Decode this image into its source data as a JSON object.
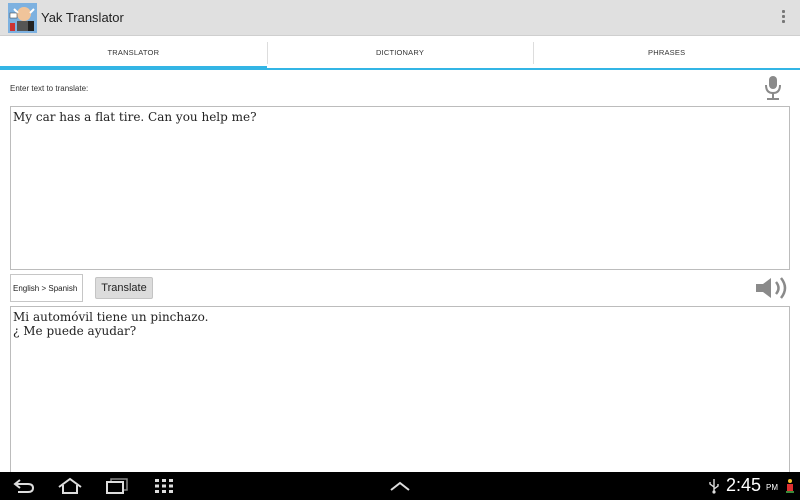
{
  "app": {
    "title": "Yak Translator"
  },
  "tabs": [
    {
      "label": "TRANSLATOR",
      "active": true
    },
    {
      "label": "DICTIONARY",
      "active": false
    },
    {
      "label": "PHRASES",
      "active": false
    }
  ],
  "translator": {
    "prompt": "Enter text to translate:",
    "input_text": "My car has a flat tire. Can you help me?",
    "language_pair": "English > Spanish",
    "translate_label": "Translate",
    "output_text": "Mi automóvil tiene un pinchazo.\n¿ Me puede ayudar?"
  },
  "statusbar": {
    "time": "2:45",
    "ampm": "PM"
  },
  "colors": {
    "accent": "#33b5e5",
    "actionbar": "#e0e0e0",
    "systembar": "#000000"
  }
}
